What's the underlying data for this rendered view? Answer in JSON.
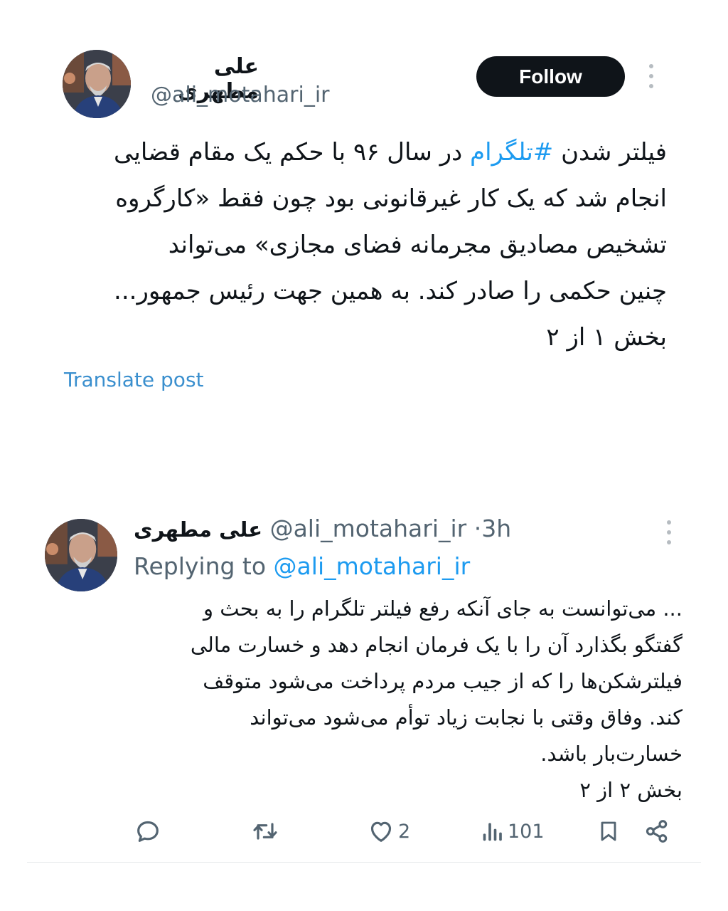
{
  "post1": {
    "author_name": "علی مطهری",
    "author_handle": "@ali_motahari_ir",
    "follow_label": "Follow",
    "text_lines": [
      [
        "فیلتر شدن ",
        "#تلگرام",
        " در سال ۹۶ با حکم یک مقام قضایی"
      ],
      "انجام شد که یک کار غیرقانونی بود چون فقط «کارگروه",
      "تشخیص مصادیق مجرمانه فضای مجازی» می‌تواند",
      "چنین حکمی را صادر کند. به همین جهت رئیس جمهور...",
      "بخش ۱ از ۲"
    ],
    "hashtag": "#تلگرام",
    "translate_label": "Translate post"
  },
  "post2": {
    "author_name": "علی مطهری",
    "author_handle": "@ali_motahari_ir",
    "separator": "·",
    "time": "3h",
    "replying_prefix": "Replying to",
    "replying_to": "@ali_motahari_ir",
    "text_lines": [
      "... می‌توانست به جای آنکه رفع فیلتر تلگرام را به بحث و",
      "گفتگو بگذارد آن را با یک فرمان انجام دهد و خسارت مالی",
      "فیلترشکن‌ها را که از جیب مردم پرداخت می‌شود متوقف",
      "کند. وفاق وقتی با نجابت زیاد توأم می‌شود می‌تواند",
      "خسارت‌بار باشد.",
      "بخش ۲ از ۲"
    ],
    "actions": {
      "reply_count": "",
      "repost_count": "",
      "like_count": "2",
      "views_count": "101"
    }
  },
  "icons": {
    "more": "more-vertical-icon",
    "reply": "reply-icon",
    "repost": "repost-icon",
    "like": "heart-icon",
    "views": "views-icon",
    "bookmark": "bookmark-icon",
    "share": "share-icon"
  },
  "colors": {
    "link": "#1d9bf0",
    "text": "#0f1419",
    "muted": "#536471",
    "button_bg": "#0f1419",
    "button_text": "#ffffff"
  }
}
